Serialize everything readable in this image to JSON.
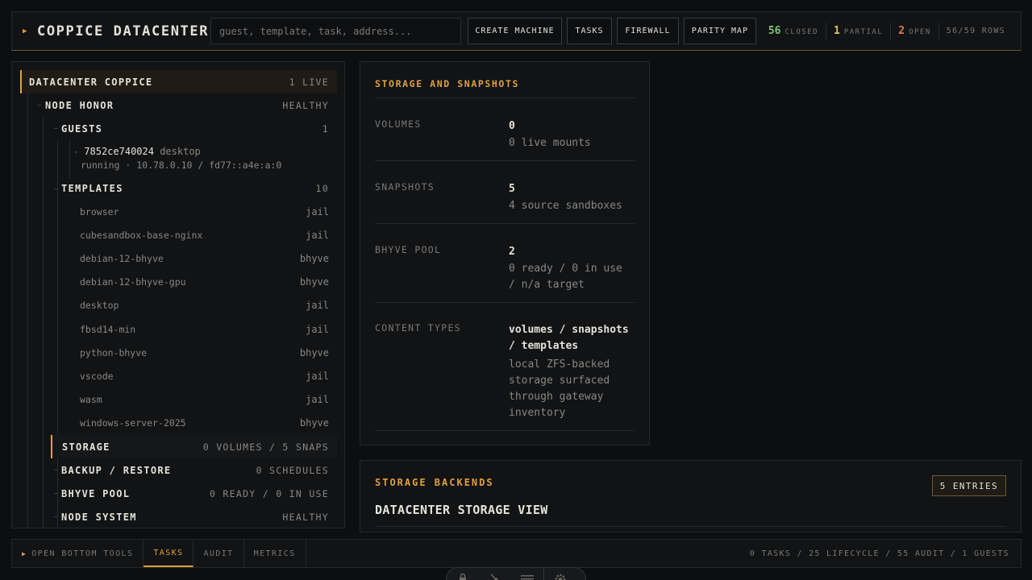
{
  "topbar": {
    "title": "COPPICE DATACENTER",
    "search_placeholder": "guest, template, task, address...",
    "buttons": [
      "CREATE MACHINE",
      "TASKS",
      "FIREWALL",
      "PARITY MAP"
    ],
    "stats": [
      {
        "num": "56",
        "label": "CLOSED",
        "color": "#7fc47a"
      },
      {
        "num": "1",
        "label": "PARTIAL",
        "color": "#e0c060"
      },
      {
        "num": "2",
        "label": "OPEN",
        "color": "#e07850"
      }
    ],
    "rows": "56/59 ROWS"
  },
  "tree": {
    "root": {
      "label": "DATACENTER COPPICE",
      "value": "1 LIVE"
    },
    "node": {
      "label": "NODE HONOR",
      "value": "HEALTHY"
    },
    "guests": {
      "label": "GUESTS",
      "value": "1"
    },
    "guest": {
      "id": "7852ce740024",
      "name": "desktop",
      "status": "running · 10.78.0.10 / fd77::a4e:a:0"
    },
    "templates": {
      "label": "TEMPLATES",
      "value": "10"
    },
    "template_items": [
      {
        "name": "browser",
        "type": "jail"
      },
      {
        "name": "cubesandbox-base-nginx",
        "type": "jail"
      },
      {
        "name": "debian-12-bhyve",
        "type": "bhyve"
      },
      {
        "name": "debian-12-bhyve-gpu",
        "type": "bhyve"
      },
      {
        "name": "desktop",
        "type": "jail"
      },
      {
        "name": "fbsd14-min",
        "type": "jail"
      },
      {
        "name": "python-bhyve",
        "type": "bhyve"
      },
      {
        "name": "vscode",
        "type": "jail"
      },
      {
        "name": "wasm",
        "type": "jail"
      },
      {
        "name": "windows-server-2025",
        "type": "bhyve"
      }
    ],
    "storage": {
      "label": "STORAGE",
      "value": "0 VOLUMES / 5 SNAPS"
    },
    "backup": {
      "label": "BACKUP / RESTORE",
      "value": "0 SCHEDULES"
    },
    "bhyve": {
      "label": "BHYVE POOL",
      "value": "0 READY / 0 IN USE"
    },
    "system": {
      "label": "NODE SYSTEM",
      "value": "HEALTHY"
    }
  },
  "storage_card": {
    "title": "STORAGE AND SNAPSHOTS",
    "rows": [
      {
        "key": "VOLUMES",
        "value": "0",
        "detail": "0 live mounts"
      },
      {
        "key": "SNAPSHOTS",
        "value": "5",
        "detail": "4 source sandboxes"
      },
      {
        "key": "BHYVE POOL",
        "value": "2",
        "detail": "0 ready / 0 in use / n/a target"
      },
      {
        "key": "CONTENT TYPES",
        "value": "volumes / snapshots / templates",
        "detail": "local ZFS-backed storage surfaced through gateway inventory"
      }
    ]
  },
  "backends": {
    "title": "STORAGE BACKENDS",
    "heading": "DATACENTER STORAGE VIEW",
    "badge": "5 ENTRIES"
  },
  "bottombar": {
    "open_label": "OPEN BOTTOM TOOLS",
    "tabs": [
      "TASKS",
      "AUDIT",
      "METRICS"
    ],
    "summary": "0 TASKS / 25 LIFECYCLE / 55 AUDIT / 1 GUESTS"
  }
}
